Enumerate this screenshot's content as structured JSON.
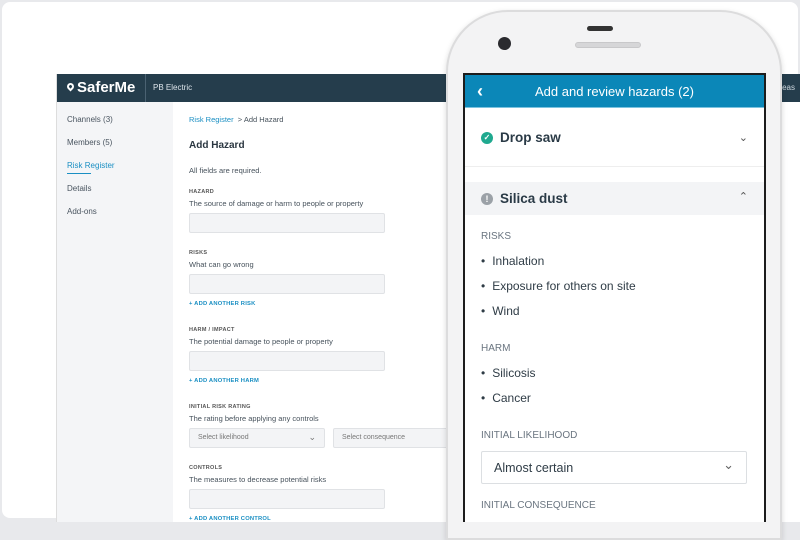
{
  "app": {
    "brand": "SaferMe",
    "org": "PB Electric",
    "areas": "Areas"
  },
  "sidebar": {
    "items": [
      {
        "label": "Channels (3)"
      },
      {
        "label": "Members (5)"
      },
      {
        "label": "Risk Register",
        "active": true
      },
      {
        "label": "Details"
      },
      {
        "label": "Add-ons"
      }
    ]
  },
  "main": {
    "breadcrumb": {
      "parent": "Risk Register",
      "sep": ">",
      "current": "Add Hazard"
    },
    "title": "Add Hazard",
    "required": "All fields are required.",
    "hazard": {
      "label": "HAZARD",
      "help": "The source of damage or harm to people or property",
      "value": ""
    },
    "risks": {
      "label": "RISKS",
      "help": "What can go wrong",
      "value": "",
      "add": "+ ADD ANOTHER RISK"
    },
    "harm": {
      "label": "HARM / IMPACT",
      "help": "The potential damage to people or property",
      "value": "",
      "add": "+ ADD ANOTHER HARM"
    },
    "rating": {
      "label": "INITIAL RISK RATING",
      "help": "The rating before applying any controls",
      "likelihood": "Select likelihood",
      "consequence": "Select consequence"
    },
    "controls": {
      "label": "CONTROLS",
      "help": "The measures to decrease potential risks",
      "value": "",
      "add": "+ ADD ANOTHER CONTROL"
    }
  },
  "phone": {
    "title": "Add and review hazards (2)",
    "hazards": [
      {
        "name": "Drop saw",
        "status": "complete",
        "expanded": false
      },
      {
        "name": "Silica dust",
        "status": "warning",
        "expanded": true
      }
    ],
    "risks_label": "RISKS",
    "risks": [
      "Inhalation",
      "Exposure for others on site",
      "Wind"
    ],
    "harm_label": "HARM",
    "harm": [
      "Silicosis",
      "Cancer"
    ],
    "likelihood_label": "INITIAL LIKELIHOOD",
    "likelihood": "Almost certain",
    "consequence_label": "INITIAL CONSEQUENCE"
  },
  "colors": {
    "topbar": "#253d4c",
    "accent": "#1a8fc3",
    "phone_header": "#0b87b8",
    "check": "#1fa98f"
  }
}
